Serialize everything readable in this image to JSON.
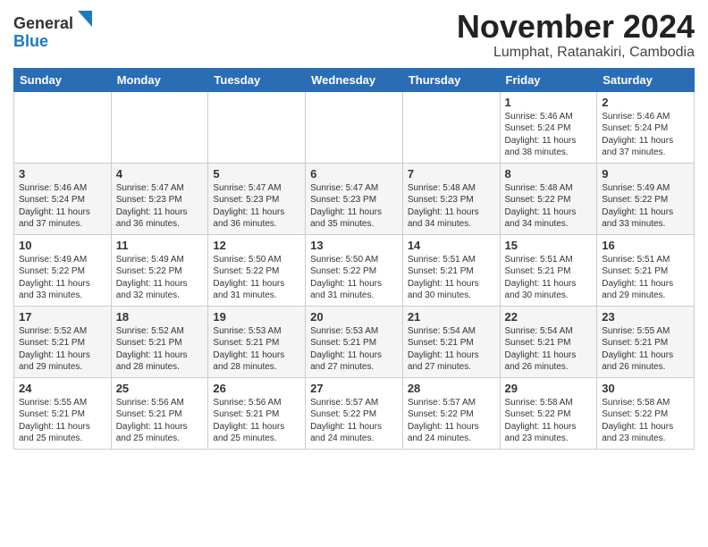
{
  "header": {
    "logo_line1": "General",
    "logo_line2": "Blue",
    "title": "November 2024",
    "subtitle": "Lumphat, Ratanakiri, Cambodia"
  },
  "calendar": {
    "days_of_week": [
      "Sunday",
      "Monday",
      "Tuesday",
      "Wednesday",
      "Thursday",
      "Friday",
      "Saturday"
    ],
    "weeks": [
      [
        {
          "day": "",
          "info": ""
        },
        {
          "day": "",
          "info": ""
        },
        {
          "day": "",
          "info": ""
        },
        {
          "day": "",
          "info": ""
        },
        {
          "day": "",
          "info": ""
        },
        {
          "day": "1",
          "info": "Sunrise: 5:46 AM\nSunset: 5:24 PM\nDaylight: 11 hours\nand 38 minutes."
        },
        {
          "day": "2",
          "info": "Sunrise: 5:46 AM\nSunset: 5:24 PM\nDaylight: 11 hours\nand 37 minutes."
        }
      ],
      [
        {
          "day": "3",
          "info": "Sunrise: 5:46 AM\nSunset: 5:24 PM\nDaylight: 11 hours\nand 37 minutes."
        },
        {
          "day": "4",
          "info": "Sunrise: 5:47 AM\nSunset: 5:23 PM\nDaylight: 11 hours\nand 36 minutes."
        },
        {
          "day": "5",
          "info": "Sunrise: 5:47 AM\nSunset: 5:23 PM\nDaylight: 11 hours\nand 36 minutes."
        },
        {
          "day": "6",
          "info": "Sunrise: 5:47 AM\nSunset: 5:23 PM\nDaylight: 11 hours\nand 35 minutes."
        },
        {
          "day": "7",
          "info": "Sunrise: 5:48 AM\nSunset: 5:23 PM\nDaylight: 11 hours\nand 34 minutes."
        },
        {
          "day": "8",
          "info": "Sunrise: 5:48 AM\nSunset: 5:22 PM\nDaylight: 11 hours\nand 34 minutes."
        },
        {
          "day": "9",
          "info": "Sunrise: 5:49 AM\nSunset: 5:22 PM\nDaylight: 11 hours\nand 33 minutes."
        }
      ],
      [
        {
          "day": "10",
          "info": "Sunrise: 5:49 AM\nSunset: 5:22 PM\nDaylight: 11 hours\nand 33 minutes."
        },
        {
          "day": "11",
          "info": "Sunrise: 5:49 AM\nSunset: 5:22 PM\nDaylight: 11 hours\nand 32 minutes."
        },
        {
          "day": "12",
          "info": "Sunrise: 5:50 AM\nSunset: 5:22 PM\nDaylight: 11 hours\nand 31 minutes."
        },
        {
          "day": "13",
          "info": "Sunrise: 5:50 AM\nSunset: 5:22 PM\nDaylight: 11 hours\nand 31 minutes."
        },
        {
          "day": "14",
          "info": "Sunrise: 5:51 AM\nSunset: 5:21 PM\nDaylight: 11 hours\nand 30 minutes."
        },
        {
          "day": "15",
          "info": "Sunrise: 5:51 AM\nSunset: 5:21 PM\nDaylight: 11 hours\nand 30 minutes."
        },
        {
          "day": "16",
          "info": "Sunrise: 5:51 AM\nSunset: 5:21 PM\nDaylight: 11 hours\nand 29 minutes."
        }
      ],
      [
        {
          "day": "17",
          "info": "Sunrise: 5:52 AM\nSunset: 5:21 PM\nDaylight: 11 hours\nand 29 minutes."
        },
        {
          "day": "18",
          "info": "Sunrise: 5:52 AM\nSunset: 5:21 PM\nDaylight: 11 hours\nand 28 minutes."
        },
        {
          "day": "19",
          "info": "Sunrise: 5:53 AM\nSunset: 5:21 PM\nDaylight: 11 hours\nand 28 minutes."
        },
        {
          "day": "20",
          "info": "Sunrise: 5:53 AM\nSunset: 5:21 PM\nDaylight: 11 hours\nand 27 minutes."
        },
        {
          "day": "21",
          "info": "Sunrise: 5:54 AM\nSunset: 5:21 PM\nDaylight: 11 hours\nand 27 minutes."
        },
        {
          "day": "22",
          "info": "Sunrise: 5:54 AM\nSunset: 5:21 PM\nDaylight: 11 hours\nand 26 minutes."
        },
        {
          "day": "23",
          "info": "Sunrise: 5:55 AM\nSunset: 5:21 PM\nDaylight: 11 hours\nand 26 minutes."
        }
      ],
      [
        {
          "day": "24",
          "info": "Sunrise: 5:55 AM\nSunset: 5:21 PM\nDaylight: 11 hours\nand 25 minutes."
        },
        {
          "day": "25",
          "info": "Sunrise: 5:56 AM\nSunset: 5:21 PM\nDaylight: 11 hours\nand 25 minutes."
        },
        {
          "day": "26",
          "info": "Sunrise: 5:56 AM\nSunset: 5:21 PM\nDaylight: 11 hours\nand 25 minutes."
        },
        {
          "day": "27",
          "info": "Sunrise: 5:57 AM\nSunset: 5:22 PM\nDaylight: 11 hours\nand 24 minutes."
        },
        {
          "day": "28",
          "info": "Sunrise: 5:57 AM\nSunset: 5:22 PM\nDaylight: 11 hours\nand 24 minutes."
        },
        {
          "day": "29",
          "info": "Sunrise: 5:58 AM\nSunset: 5:22 PM\nDaylight: 11 hours\nand 23 minutes."
        },
        {
          "day": "30",
          "info": "Sunrise: 5:58 AM\nSunset: 5:22 PM\nDaylight: 11 hours\nand 23 minutes."
        }
      ]
    ]
  }
}
